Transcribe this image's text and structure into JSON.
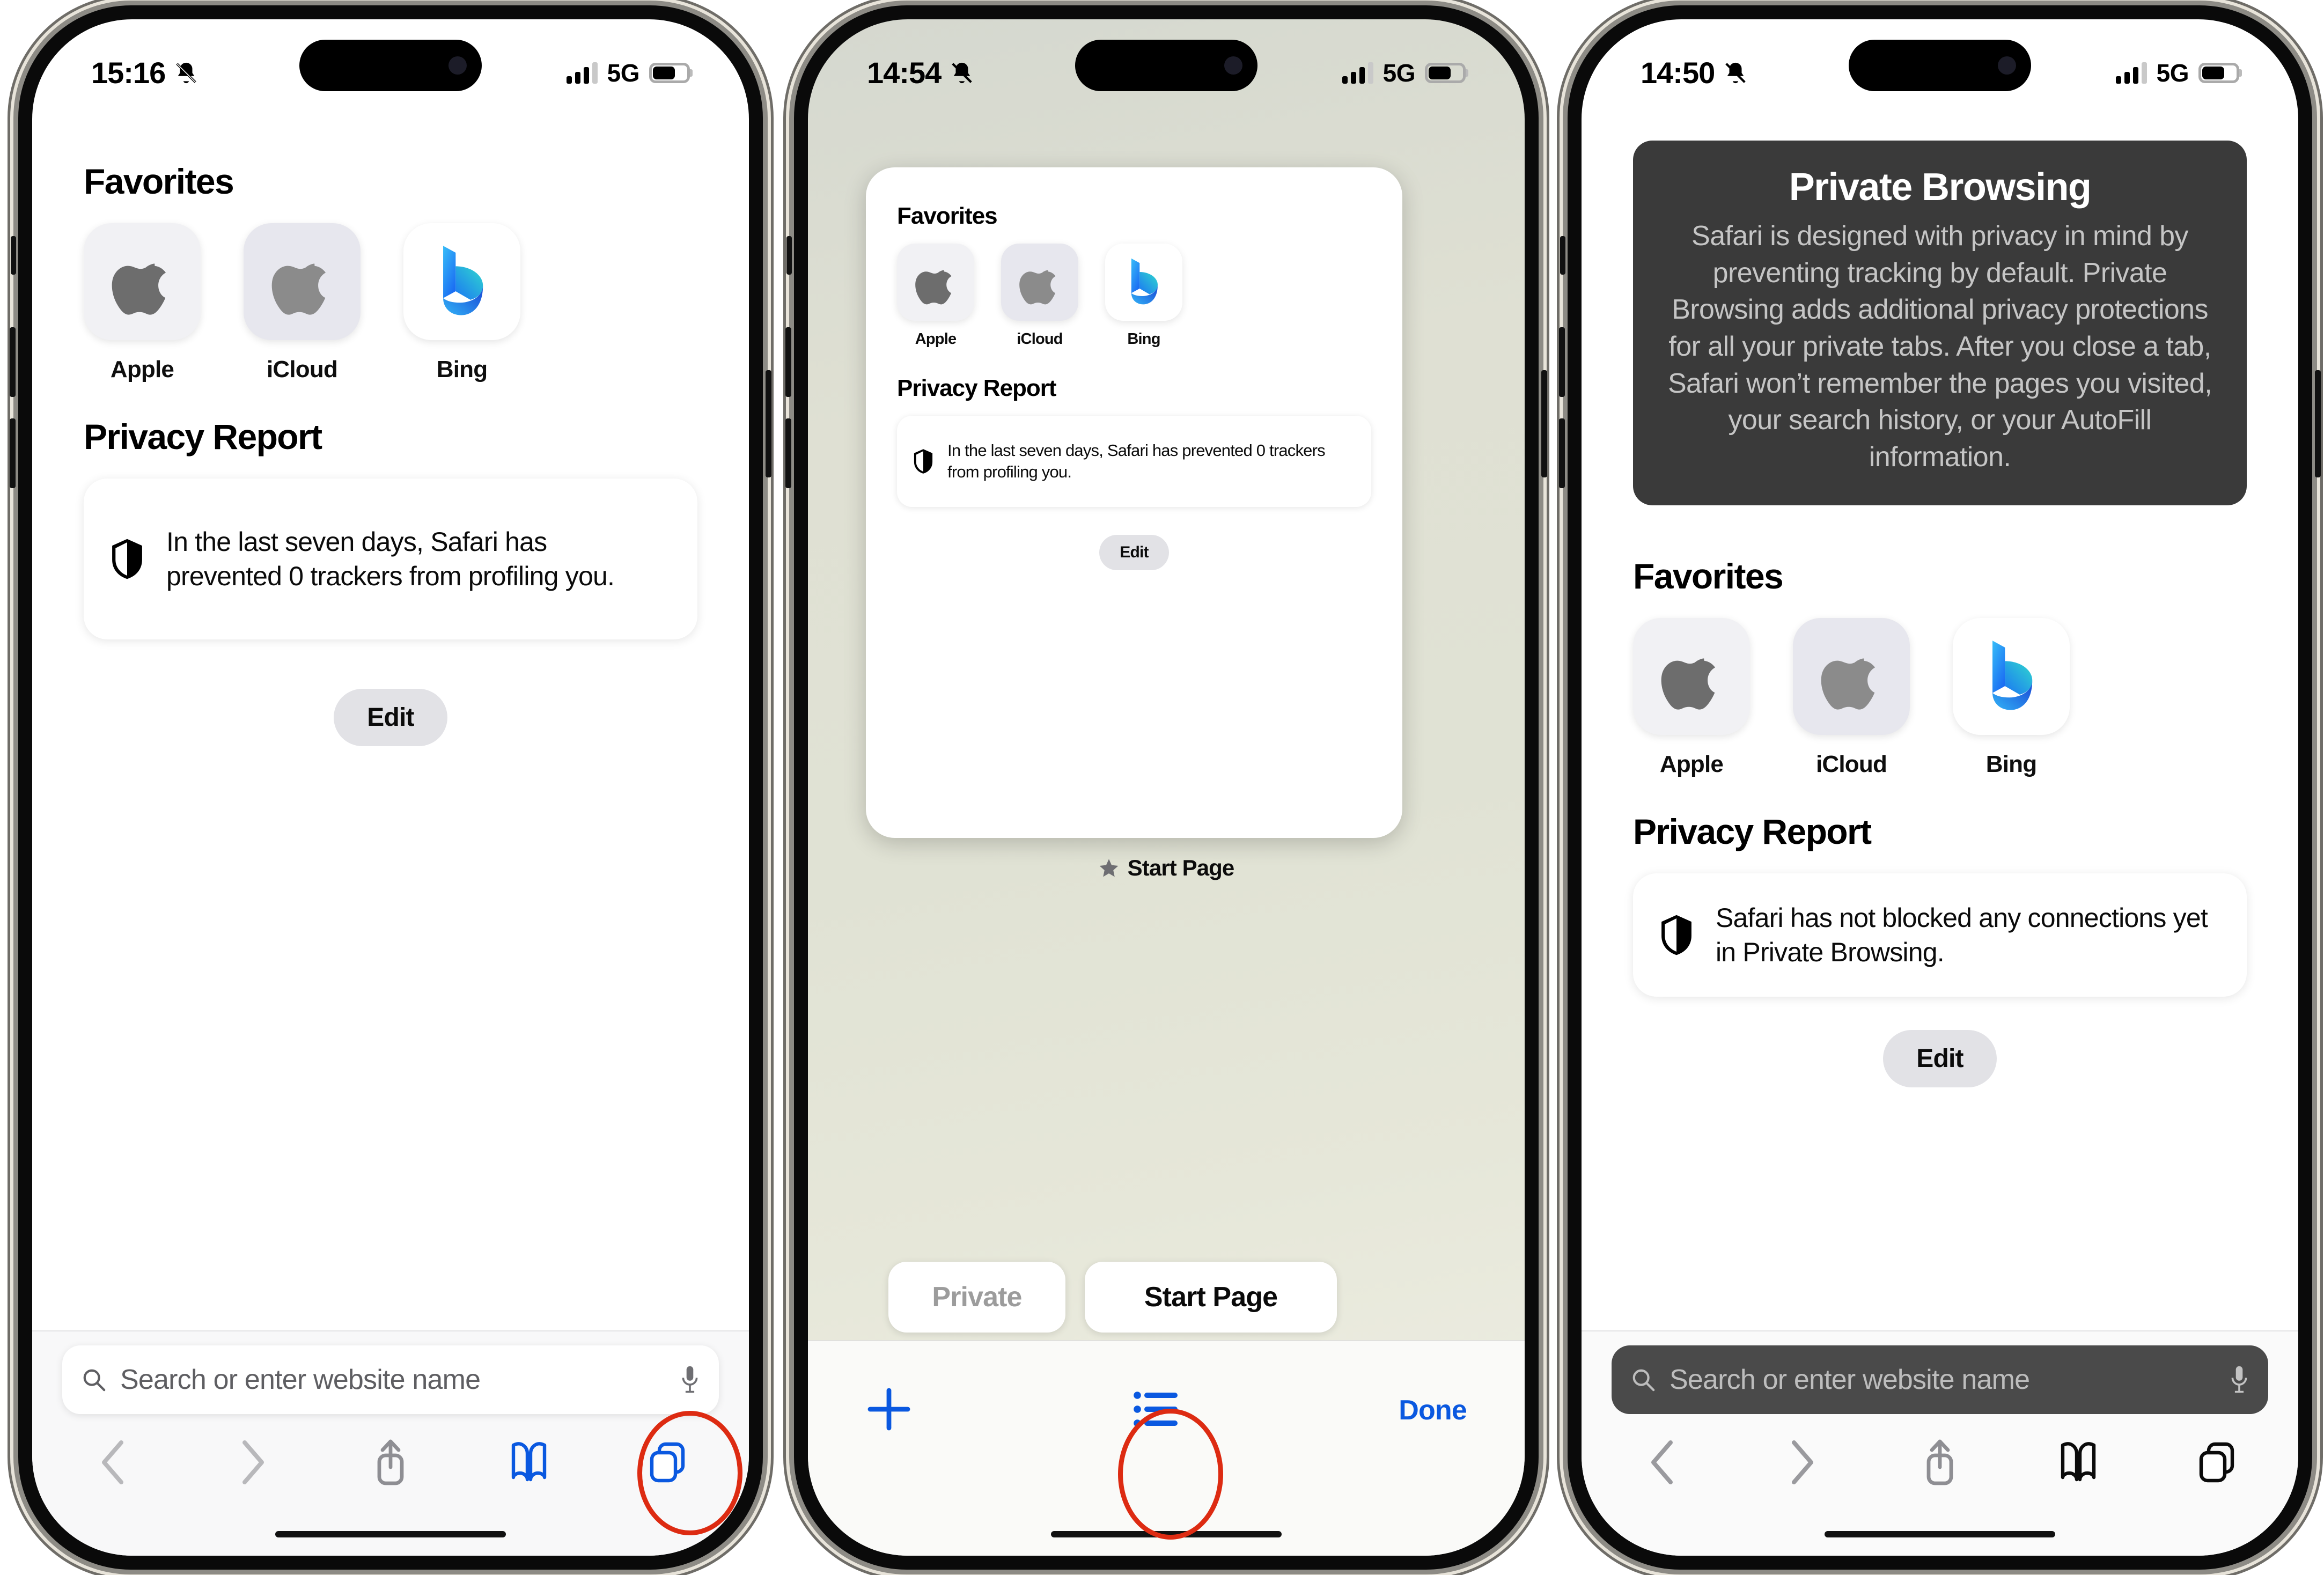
{
  "phones": [
    {
      "id": "phone-start-page",
      "status": {
        "time": "15:16",
        "silent_icon": "bell-slash-icon",
        "network": "5G",
        "signal_icon": "cellular-bars-icon",
        "battery_icon": "battery-icon"
      },
      "sections": {
        "favorites_title": "Favorites",
        "privacy_title": "Privacy Report",
        "privacy_text": "In the last seven days, Safari has prevented 0 trackers from profiling you.",
        "edit_label": "Edit"
      },
      "favorites": [
        {
          "label": "Apple",
          "icon": "apple-logo-icon"
        },
        {
          "label": "iCloud",
          "icon": "apple-logo-icon"
        },
        {
          "label": "Bing",
          "icon": "bing-logo-icon"
        }
      ],
      "search": {
        "placeholder": "Search or enter website name",
        "search_icon": "search-icon",
        "mic_icon": "microphone-icon"
      },
      "toolbar": [
        {
          "name": "back-button",
          "icon": "chevron-left-icon",
          "color": "#b8b8bb"
        },
        {
          "name": "forward-button",
          "icon": "chevron-right-icon",
          "color": "#b8b8bb"
        },
        {
          "name": "share-button",
          "icon": "share-icon",
          "color": "#8e8e93"
        },
        {
          "name": "bookmarks-button",
          "icon": "book-icon",
          "color": "#0a58e0"
        },
        {
          "name": "tabs-button",
          "icon": "tabs-icon",
          "color": "#0a58e0"
        }
      ],
      "annotation": "tabs-button-highlight"
    },
    {
      "id": "phone-tab-switcher",
      "status": {
        "time": "14:54",
        "silent_icon": "bell-slash-icon",
        "network": "5G",
        "signal_icon": "cellular-bars-icon",
        "battery_icon": "battery-icon"
      },
      "sections": {
        "favorites_title": "Favorites",
        "privacy_title": "Privacy Report",
        "privacy_text": "In the last seven days, Safari has prevented 0 trackers from profiling you.",
        "edit_label": "Edit"
      },
      "favorites": [
        {
          "label": "Apple",
          "icon": "apple-logo-icon"
        },
        {
          "label": "iCloud",
          "icon": "apple-logo-icon"
        },
        {
          "label": "Bing",
          "icon": "bing-logo-icon"
        }
      ],
      "tab_title": "Start Page",
      "tab_title_icon": "star-icon",
      "group_pills": [
        {
          "label": "Private",
          "state": "inactive"
        },
        {
          "label": "Start Page",
          "state": "active"
        }
      ],
      "actions": {
        "new_tab_icon": "plus-icon",
        "tab_groups_icon": "list-icon",
        "done_label": "Done"
      },
      "annotation": "tab-groups-button-highlight"
    },
    {
      "id": "phone-private-browsing",
      "status": {
        "time": "14:50",
        "silent_icon": "bell-slash-icon",
        "network": "5G",
        "signal_icon": "cellular-bars-icon",
        "battery_icon": "battery-icon"
      },
      "banner": {
        "title": "Private Browsing",
        "body": "Safari is designed with privacy in mind by preventing tracking by default. Private Browsing adds additional privacy protections for all your private tabs. After you close a tab, Safari won’t remember the pages you visited, your search history, or your AutoFill information."
      },
      "sections": {
        "favorites_title": "Favorites",
        "privacy_title": "Privacy Report",
        "privacy_text": "Safari has not blocked any connections yet in Private Browsing.",
        "edit_label": "Edit"
      },
      "favorites": [
        {
          "label": "Apple",
          "icon": "apple-logo-icon"
        },
        {
          "label": "iCloud",
          "icon": "apple-logo-icon"
        },
        {
          "label": "Bing",
          "icon": "bing-logo-icon"
        }
      ],
      "search": {
        "placeholder": "Search or enter website name",
        "search_icon": "search-icon",
        "mic_icon": "microphone-icon"
      },
      "toolbar": [
        {
          "name": "back-button",
          "icon": "chevron-left-icon",
          "color": "#9a9a9e"
        },
        {
          "name": "forward-button",
          "icon": "chevron-right-icon",
          "color": "#9a9a9e"
        },
        {
          "name": "share-button",
          "icon": "share-icon",
          "color": "#8e8e93"
        },
        {
          "name": "bookmarks-button",
          "icon": "book-icon",
          "color": "#0b0b0b"
        },
        {
          "name": "tabs-button",
          "icon": "tabs-icon",
          "color": "#0b0b0b"
        }
      ]
    }
  ],
  "colors": {
    "accent_blue": "#0a58e0",
    "annotation_red": "#dd2b12",
    "private_banner_bg": "#3a3a3a",
    "private_search_bg": "#4a4a4a"
  }
}
